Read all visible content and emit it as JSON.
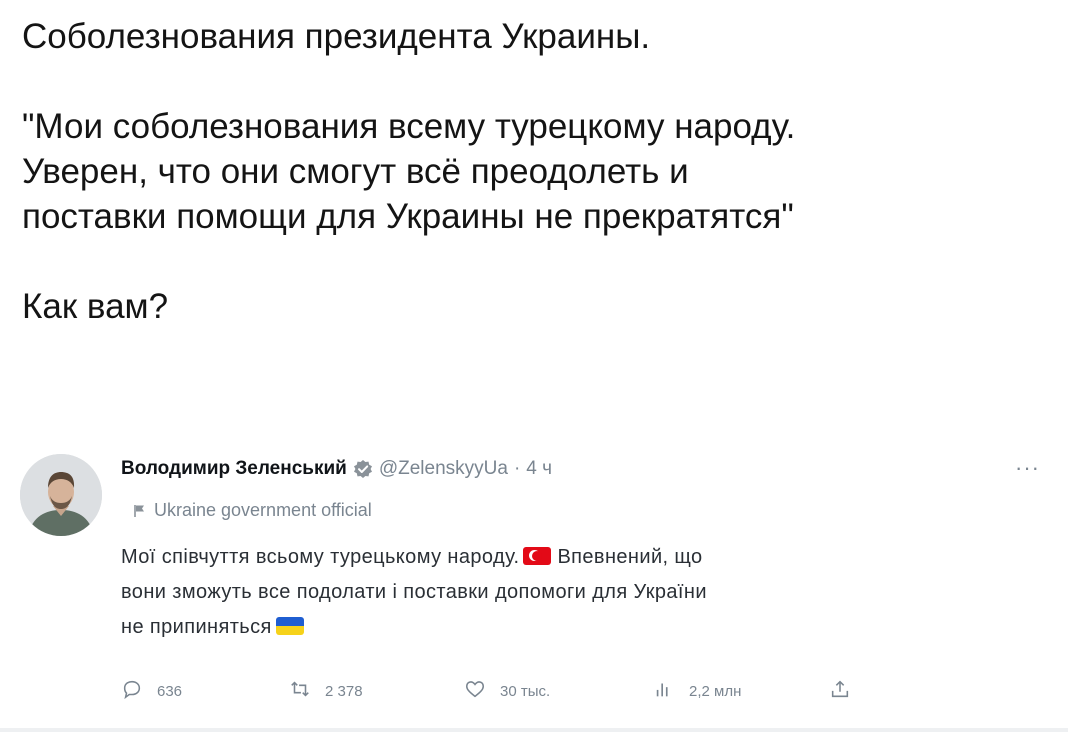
{
  "post": {
    "title_line": "Соболезнования президента Украины.",
    "quote_lines": [
      "\"Мои соболезнования всему турецкому народу.",
      "Уверен, что они смогут всё преодолеть и",
      "поставки помощи для Украины не прекратятся\""
    ],
    "question": "Как вам?"
  },
  "tweet": {
    "author_name": "Володимир Зеленський",
    "handle": "@ZelenskyyUa",
    "separator": "·",
    "time": "4 ч",
    "affiliation": "Ukraine government official",
    "body": {
      "part1": "Мої співчуття всьому турецькому народу.",
      "part2": "Впевнений, що",
      "line2": "вони зможуть все подолати і поставки допомоги для України",
      "line3": "не припиняться"
    },
    "stats": {
      "replies": "636",
      "retweets": "2 378",
      "likes": "30 тыс.",
      "views": "2,2 млн"
    },
    "icons": [
      "verified-icon",
      "more-icon",
      "flag-icon",
      "reply-icon",
      "retweet-icon",
      "like-icon",
      "views-icon",
      "share-icon"
    ],
    "colors": {
      "verified": "#1d9bf0",
      "muted": "#7a8590",
      "flag_turkey": "#e30a17",
      "flag_ukraine_blue": "#1f5ed1",
      "flag_ukraine_yellow": "#f6d21a"
    }
  }
}
